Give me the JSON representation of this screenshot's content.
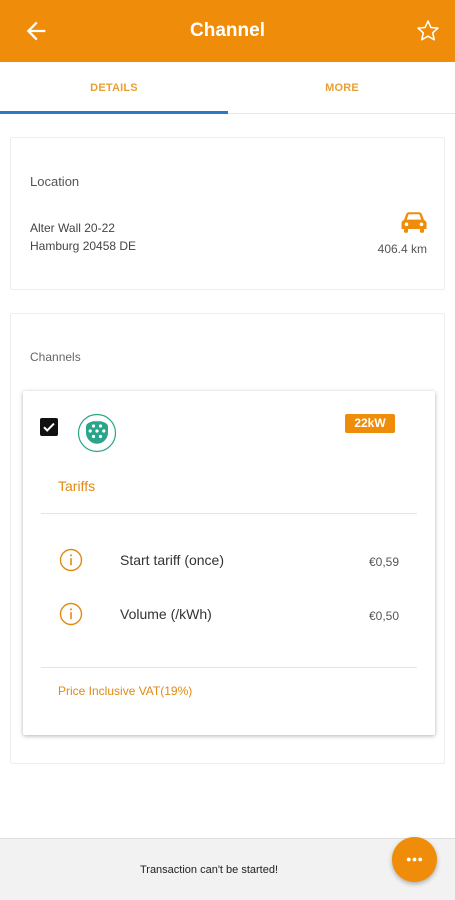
{
  "header": {
    "title": "Channel",
    "back_icon": "arrow-left-icon",
    "favorite_icon": "star-outline-icon",
    "color": "#ef8c0a"
  },
  "tabs": [
    {
      "label": "DETAILS",
      "active": true
    },
    {
      "label": "MORE",
      "active": false
    }
  ],
  "location": {
    "label": "Location",
    "address_line1": "Alter Wall 20-22",
    "address_line2": "Hamburg 20458 DE",
    "distance": "406.4 km",
    "icon": "car-icon"
  },
  "channels": {
    "label": "Channels",
    "items": [
      {
        "checked": true,
        "connector_icon": "type2-connector-icon",
        "power": "22kW",
        "tariffs_title": "Tariffs",
        "tariffs": [
          {
            "name": "Start tariff (once)",
            "price": "€0,59"
          },
          {
            "name": "Volume (/kWh)",
            "price": "€0,50"
          }
        ],
        "vat_note": "Price Inclusive VAT(19%)"
      }
    ]
  },
  "footer": {
    "message": "Transaction can't be started!",
    "fab_icon": "more-horizontal-icon"
  }
}
